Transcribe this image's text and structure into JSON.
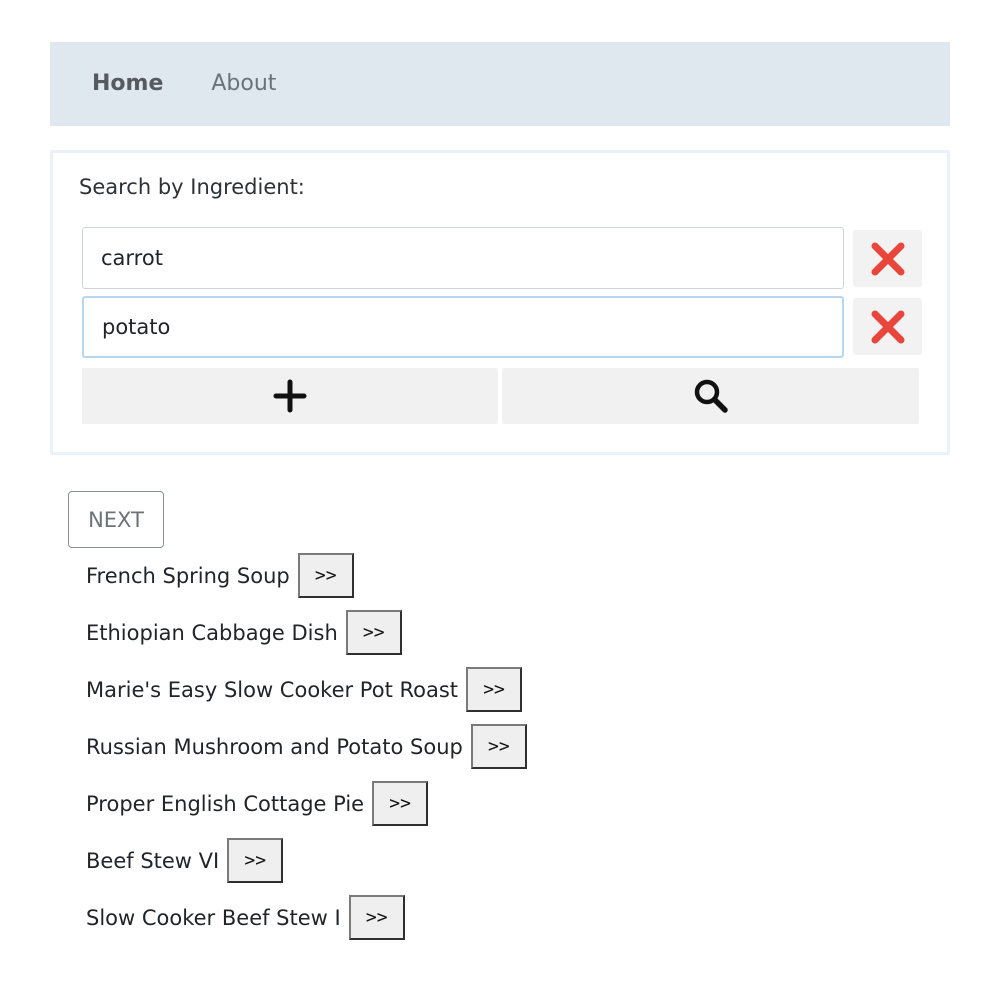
{
  "nav": {
    "home_label": "Home",
    "about_label": "About"
  },
  "search": {
    "label": "Search by Ingredient:",
    "ingredients": [
      {
        "value": "carrot"
      },
      {
        "value": "potato"
      }
    ],
    "remove_icon": "close-icon",
    "add_icon": "plus-icon",
    "search_icon": "search-icon"
  },
  "pagination": {
    "next_label": "NEXT"
  },
  "recipes": [
    {
      "name": "French Spring Soup",
      "button": ">>"
    },
    {
      "name": "Ethiopian Cabbage Dish",
      "button": ">>"
    },
    {
      "name": "Marie's Easy Slow Cooker Pot Roast",
      "button": ">>"
    },
    {
      "name": "Russian Mushroom and Potato Soup",
      "button": ">>"
    },
    {
      "name": "Proper English Cottage Pie",
      "button": ">>"
    },
    {
      "name": "Beef Stew VI",
      "button": ">>"
    },
    {
      "name": "Slow Cooker Beef Stew I",
      "button": ">>"
    }
  ],
  "colors": {
    "navbar_bg": "#dfe8ef",
    "remove_icon": "#e8453c",
    "card_border": "#eaf1f8",
    "focus_border": "#b7d6ef"
  }
}
